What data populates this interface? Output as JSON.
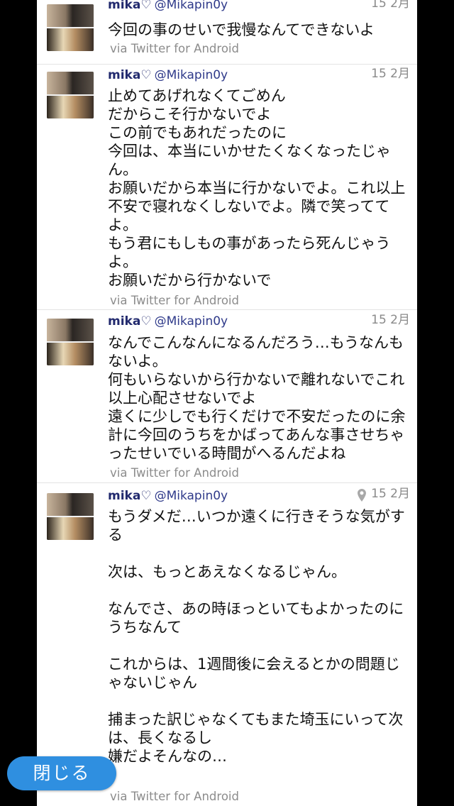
{
  "tweets": [
    {
      "name": "mika",
      "heart": "♡",
      "handle": "@Mikapin0y",
      "date": "15 2月",
      "body": "今回の事のせいで我慢なんてできないよ",
      "via": "via Twitter for Android",
      "has_location": false
    },
    {
      "name": "mika",
      "heart": "♡",
      "handle": "@Mikapin0y",
      "date": "15 2月",
      "body": "止めてあげれなくてごめん\nだからこそ行かないでよ\nこの前でもあれだったのに\n今回は、本当にいかせたくなくなったじゃん。\nお願いだから本当に行かないでよ。これ以上不安で寝れなくしないでよ。隣で笑っててよ。\nもう君にもしもの事があったら死んじゃうよ。\nお願いだから行かないで",
      "via": "via Twitter for Android",
      "has_location": false
    },
    {
      "name": "mika",
      "heart": "♡",
      "handle": "@Mikapin0y",
      "date": "15 2月",
      "body": "なんでこんなんになるんだろう…もうなんもないよ。\n何もいらないから行かないで離れないでこれ以上心配させないでよ\n遠くに少しでも行くだけで不安だったのに余計に今回のうちをかばってあんな事させちゃったせいでいる時間がへるんだよね",
      "via": "via Twitter for Android",
      "has_location": false
    },
    {
      "name": "mika",
      "heart": "♡",
      "handle": "@Mikapin0y",
      "date": "15 2月",
      "body": "もうダメだ…いつか遠くに行きそうな気がする\n\n次は、もっとあえなくなるじゃん。\n\nなんでさ、あの時ほっといてもよかったのに\nうちなんて\n\nこれからは、1週間後に会えるとかの問題じゃないじゃん\n\n捕まった訳じゃなくてもまた埼玉にいって次は、長くなるし\n嫌だよそんなの…",
      "via": "via Twitter for Android",
      "has_location": true
    }
  ],
  "close_button": {
    "label": "閉じる"
  },
  "colors": {
    "name": "#222a6e",
    "handle": "#2f3a8a",
    "meta": "#8c8c8c",
    "button": "#2f8fe0",
    "background": "#000000"
  }
}
